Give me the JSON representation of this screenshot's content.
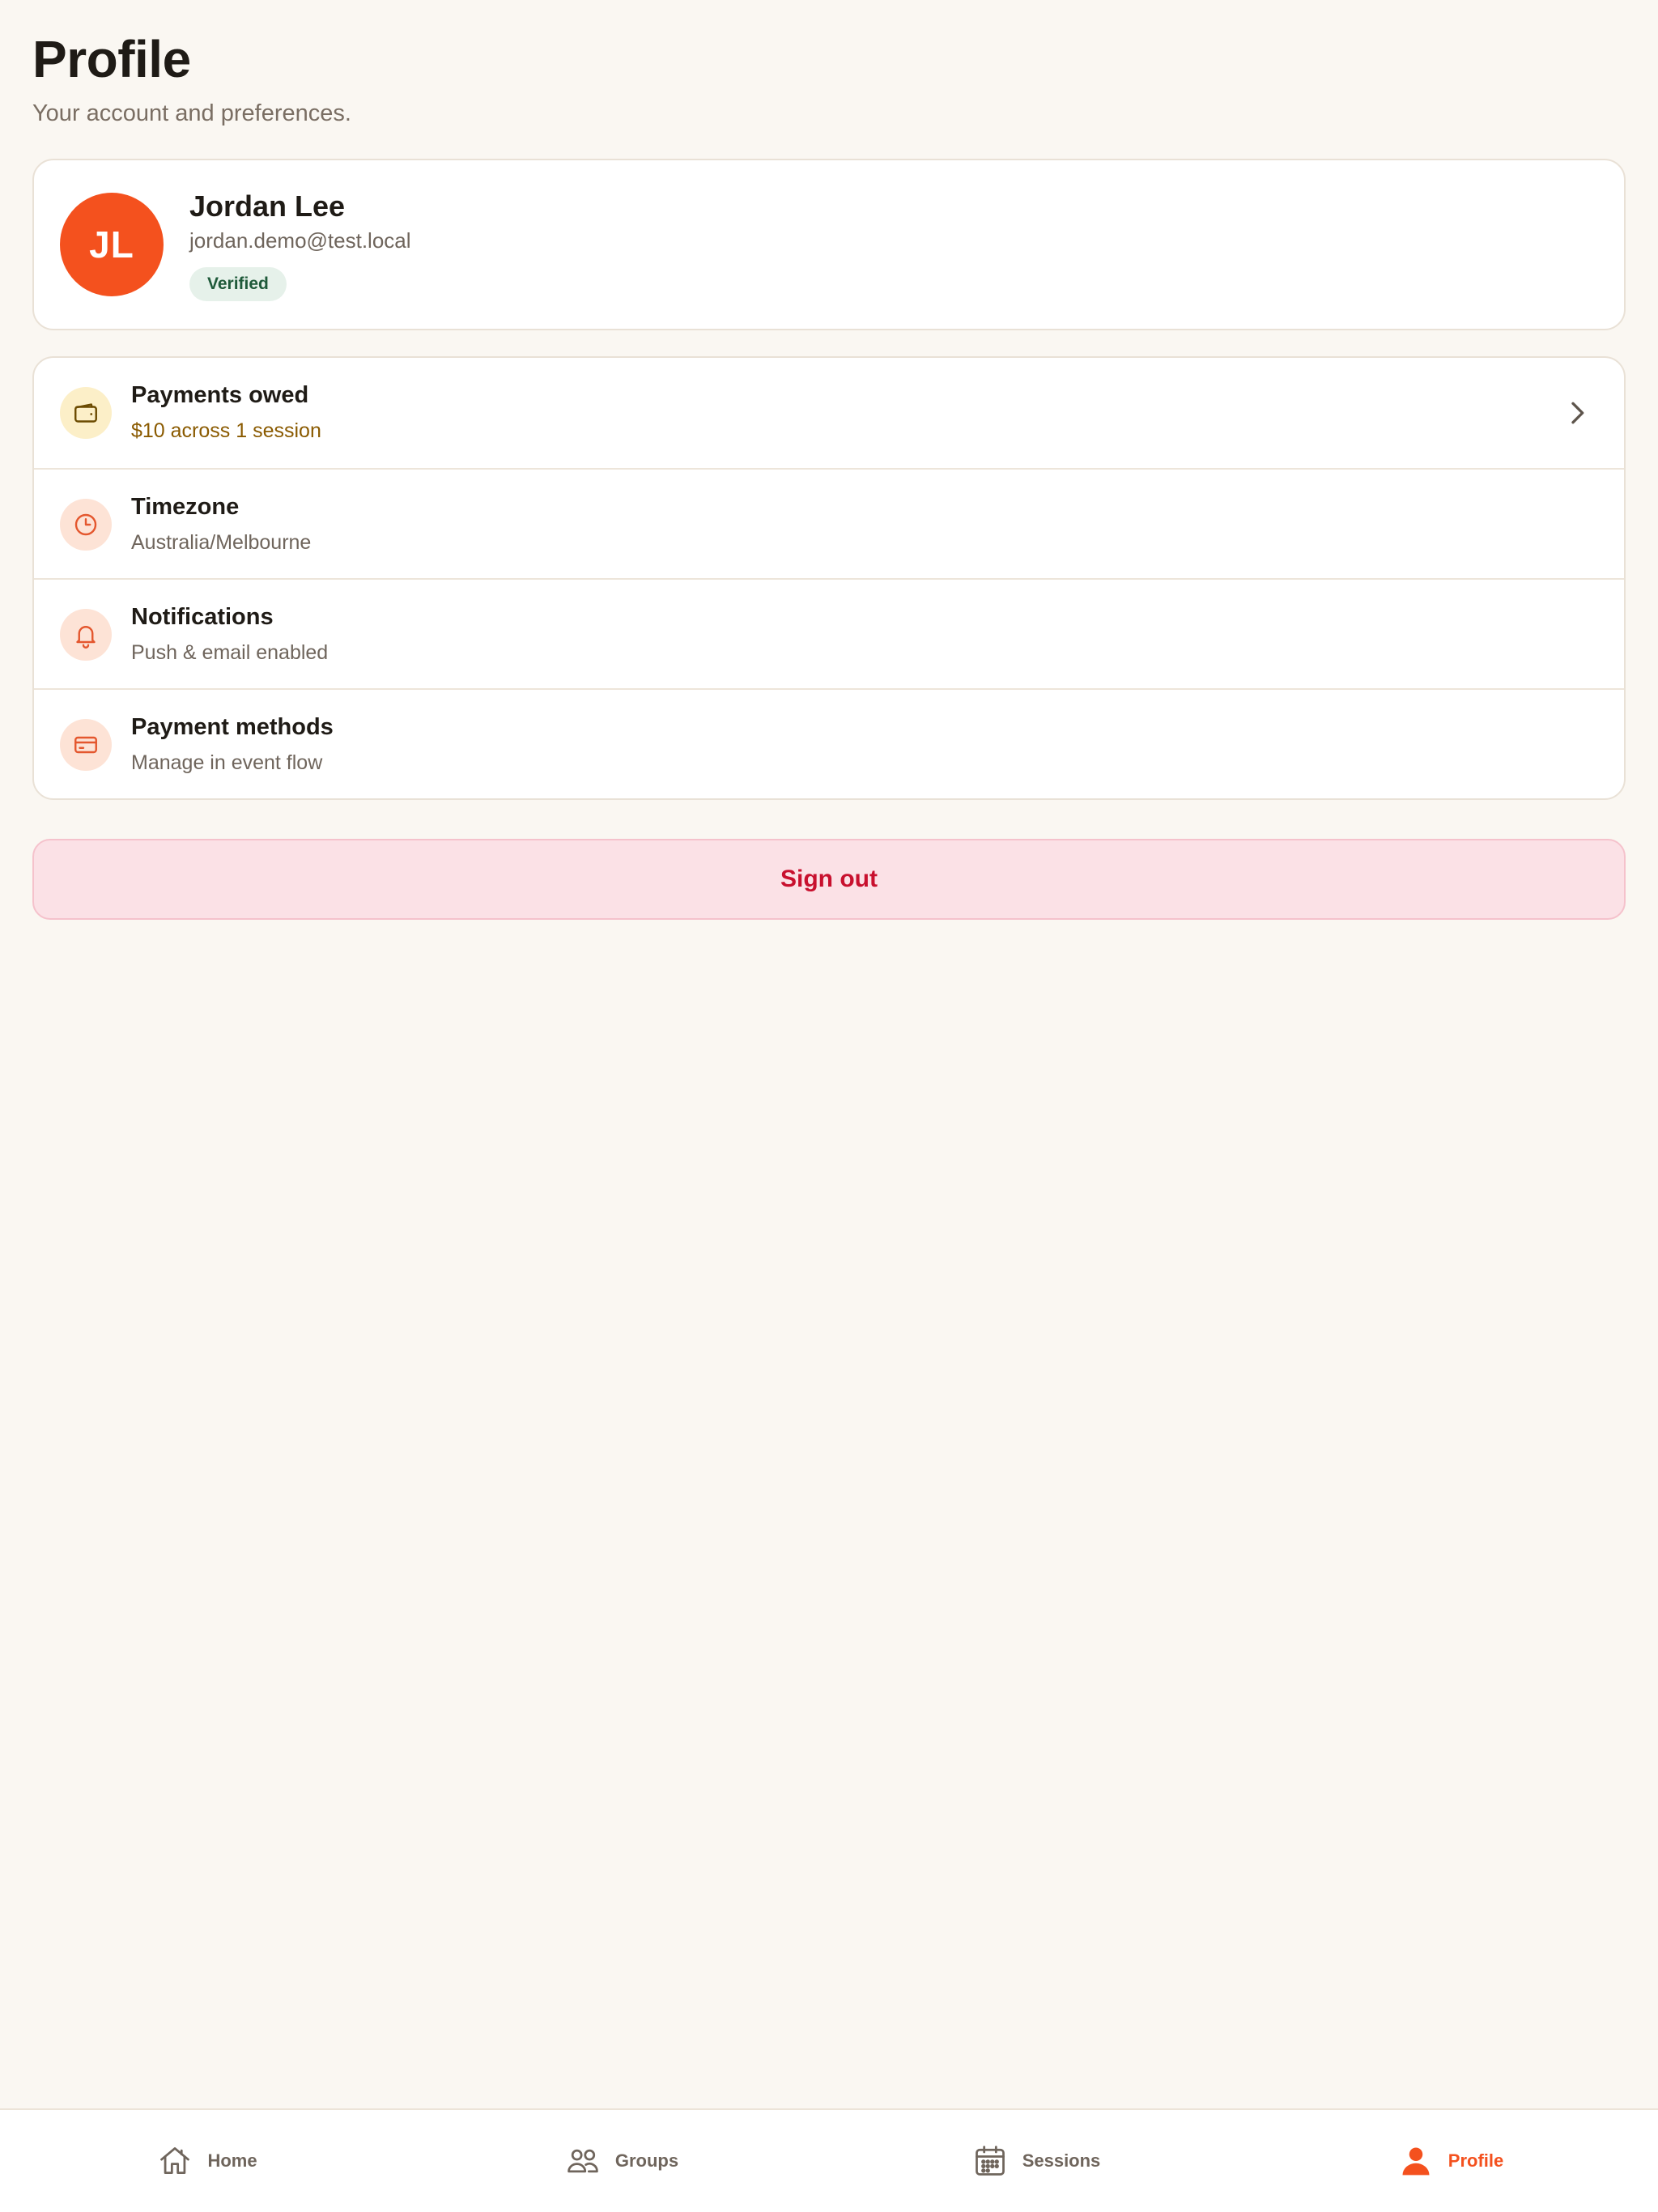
{
  "header": {
    "title": "Profile",
    "subtitle": "Your account and preferences."
  },
  "profile": {
    "initials": "JL",
    "name": "Jordan Lee",
    "email": "jordan.demo@test.local",
    "badge": "Verified",
    "avatar_color": "#F4511E"
  },
  "settings": {
    "items": [
      {
        "title": "Payments owed",
        "subtitle": "$10 across 1 session",
        "icon": "wallet-icon"
      },
      {
        "title": "Timezone",
        "subtitle": "Australia/Melbourne",
        "icon": "clock-icon"
      },
      {
        "title": "Notifications",
        "subtitle": "Push & email enabled",
        "icon": "bell-icon"
      },
      {
        "title": "Payment methods",
        "subtitle": "Manage in event flow",
        "icon": "credit-card-icon"
      }
    ]
  },
  "actions": {
    "sign_out": "Sign out"
  },
  "nav": {
    "items": [
      {
        "label": "Home",
        "icon": "home-icon"
      },
      {
        "label": "Groups",
        "icon": "users-icon"
      },
      {
        "label": "Sessions",
        "icon": "calendar-icon"
      },
      {
        "label": "Profile",
        "icon": "user-icon",
        "active": true
      }
    ]
  },
  "colors": {
    "accent": "#F4511E",
    "background": "#FAF7F2",
    "danger": "#C8102E",
    "verified": "#1F5A3A"
  }
}
